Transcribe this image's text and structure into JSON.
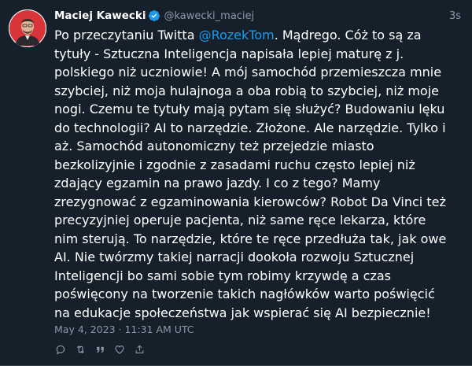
{
  "tweet": {
    "author_name": "Maciej Kawecki",
    "handle": "@kawecki_maciej",
    "relative_time": "3s",
    "lines": [
      {
        "before": "Po przeczytaniu Twitta ",
        "mention": "@RozekTom",
        "after": ". Mądrego. Cóż to są za"
      },
      {
        "text": "tytuły - Sztuczna Inteligencja napisała lepiej maturę z j."
      },
      {
        "text": "polskiego niż uczniowie! A mój samochód przemieszcza mnie"
      },
      {
        "text": "szybciej, niż moja hulajnoga a oba robią to szybciej, niż moje"
      },
      {
        "text": "nogi. Czemu te tytuły mają pytam się służyć? Budowaniu lęku"
      },
      {
        "text": "do technologii? AI to narzędzie. Złożone. Ale narzędzie. Tylko i"
      },
      {
        "text": "aż. Samochód autonomiczny też przejedzie miasto"
      },
      {
        "text": "bezkolizyjnie i zgodnie z zasadami ruchu często lepiej niż"
      },
      {
        "text": "zdający egzamin na prawo jazdy. I co z tego? Mamy"
      },
      {
        "text": "zrezygnować z egzaminowania kierowców? Robot Da Vinci też"
      },
      {
        "text": "precyzyjniej operuje pacjenta, niż same ręce lekarza, które"
      },
      {
        "text": "nim sterują. To narzędzie, które te ręce przedłuża tak, jak owe"
      },
      {
        "text": "AI. Nie twórzmy takiej narracji dookoła rozwoju Sztucznej"
      },
      {
        "text": "Inteligencji bo sami sobie tym robimy krzywdę a czas"
      },
      {
        "text": "poświęcony na tworzenie takich nagłówków warto poświęcić"
      },
      {
        "text": "na edukacje społeczeństwa jak wspierać się AI bezpiecznie!"
      }
    ],
    "date": "May 4, 2023 · 11:31 AM UTC",
    "action_icons": [
      "reply-icon",
      "retweet-icon",
      "quote-icon",
      "like-icon",
      "share-icon"
    ]
  },
  "colors": {
    "background": "#15202b",
    "text": "#ffffff",
    "muted": "#8899a6",
    "link": "#1d9bf0",
    "verified": "#1d9bf0"
  }
}
